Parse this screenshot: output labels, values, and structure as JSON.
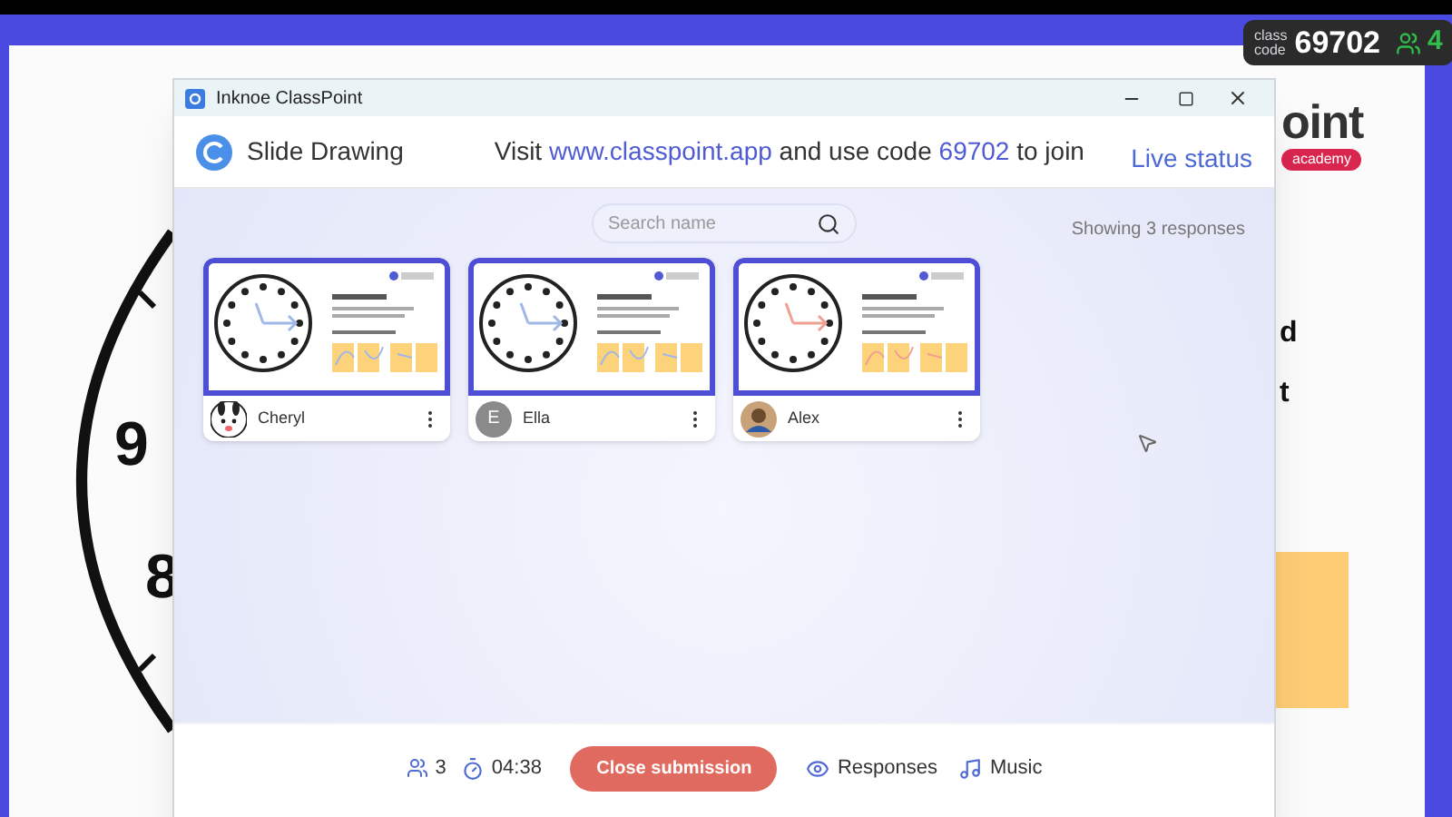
{
  "slide_background": {
    "logo_text": "oint",
    "badge": "academy",
    "letters": [
      "d",
      "t"
    ],
    "clock_numbers": [
      "9",
      "8"
    ]
  },
  "class_code": {
    "label_top": "class",
    "label_bottom": "code",
    "code": "69702",
    "participants": "4"
  },
  "window": {
    "title": "Inknoe ClassPoint"
  },
  "header": {
    "title": "Slide Drawing",
    "visit_prefix": "Visit ",
    "url": "www.classpoint.app",
    "middle": " and use code ",
    "code": "69702",
    "suffix": " to join",
    "live_status": "Live status"
  },
  "search": {
    "placeholder": "Search name"
  },
  "showing": "Showing 3 responses",
  "responses": [
    {
      "name": "Cheryl",
      "avatar": {
        "kind": "cartoon"
      },
      "color": "#9fb8e8"
    },
    {
      "name": "Ella",
      "avatar": {
        "kind": "letter",
        "letter": "E"
      },
      "color": "#9fb8e8"
    },
    {
      "name": "Alex",
      "avatar": {
        "kind": "photo"
      },
      "color": "#f0a090"
    }
  ],
  "footer": {
    "participants": "3",
    "timer": "04:38",
    "close_button": "Close submission",
    "responses": "Responses",
    "music": "Music"
  }
}
